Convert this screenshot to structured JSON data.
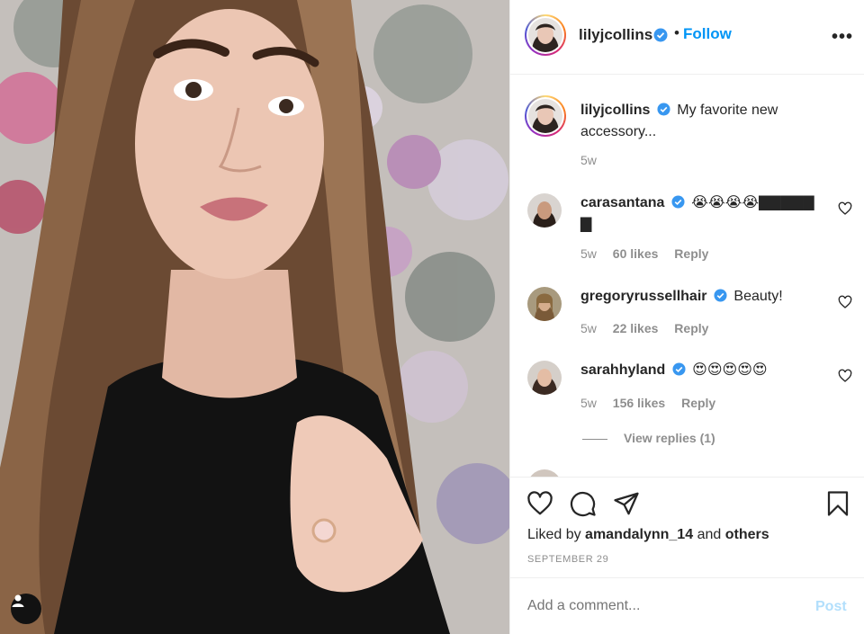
{
  "post": {
    "username": "lilyjcollins",
    "follow_label": "Follow",
    "separator": "•",
    "more_label": "•••",
    "verified_icon": "verified-badge-icon",
    "accent": "#0095f6"
  },
  "caption": {
    "username": "lilyjcollins",
    "text": "My favorite new accessory...",
    "time": "5w"
  },
  "comments": [
    {
      "username": "carasantana",
      "text": "😭😭😭😭▇▇▇▇▇ ▇",
      "time": "5w",
      "likes": "60 likes",
      "reply": "Reply"
    },
    {
      "username": "gregoryrussellhair",
      "text": "Beauty!",
      "time": "5w",
      "likes": "22 likes",
      "reply": "Reply"
    },
    {
      "username": "sarahhyland",
      "text": "😍😍😍😍😍",
      "time": "5w",
      "likes": "156 likes",
      "reply": "Reply"
    }
  ],
  "view_replies": "View replies (1)",
  "actions": {
    "liked_prefix": "Liked by",
    "liked_user": "amandalynn_14",
    "liked_and": "and",
    "liked_others": "others",
    "date": "SEPTEMBER 29"
  },
  "add_comment": {
    "placeholder": "Add a comment...",
    "post_label": "Post"
  }
}
